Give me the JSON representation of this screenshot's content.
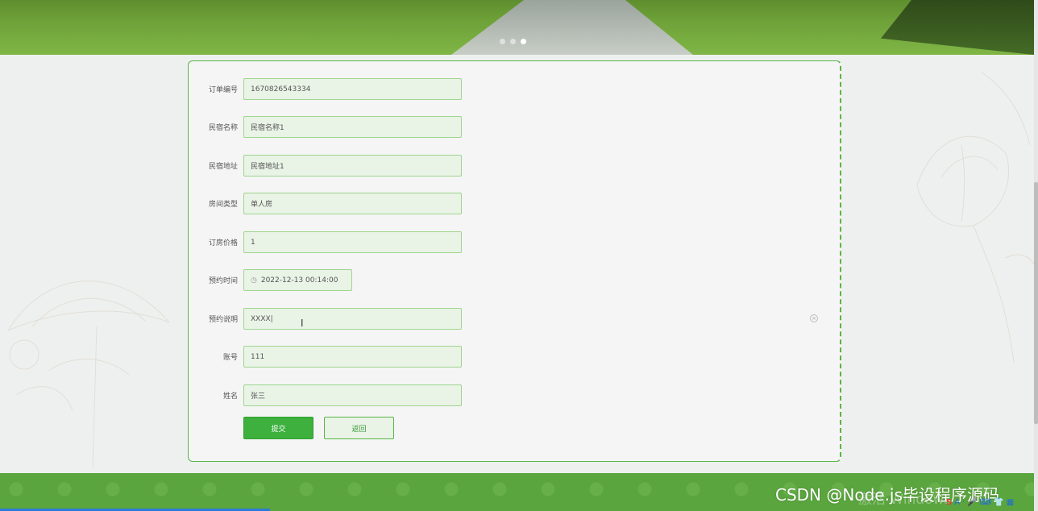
{
  "banner": {
    "carousel_dots": 3,
    "active_dot": 3
  },
  "form": {
    "fields": [
      {
        "label": "订单编号",
        "value": "1670826543334"
      },
      {
        "label": "民宿名称",
        "value": "民宿名称1"
      },
      {
        "label": "民宿地址",
        "value": "民宿地址1"
      },
      {
        "label": "房间类型",
        "value": "单人房"
      },
      {
        "label": "订房价格",
        "value": "1"
      },
      {
        "label": "预约时间",
        "value": "2022-12-13 00:14:00"
      },
      {
        "label": "预约说明",
        "value": "XXXX|"
      },
      {
        "label": "账号",
        "value": "111"
      },
      {
        "label": "姓名",
        "value": "张三"
      }
    ],
    "submit_label": "提交",
    "back_label": "返回"
  },
  "footer": {
    "watermark_faint": "激活 Windows",
    "watermark": "CSDN @Node.js毕设程序源码",
    "tray_icons": [
      "S",
      "A",
      "·",
      "🎤",
      "⌨",
      "👕",
      "▦"
    ]
  },
  "colors": {
    "accent": "#3db03d",
    "field_bg": "#e9f3e6",
    "field_border": "#9fd58f",
    "footer_bg": "#5aa53e"
  }
}
